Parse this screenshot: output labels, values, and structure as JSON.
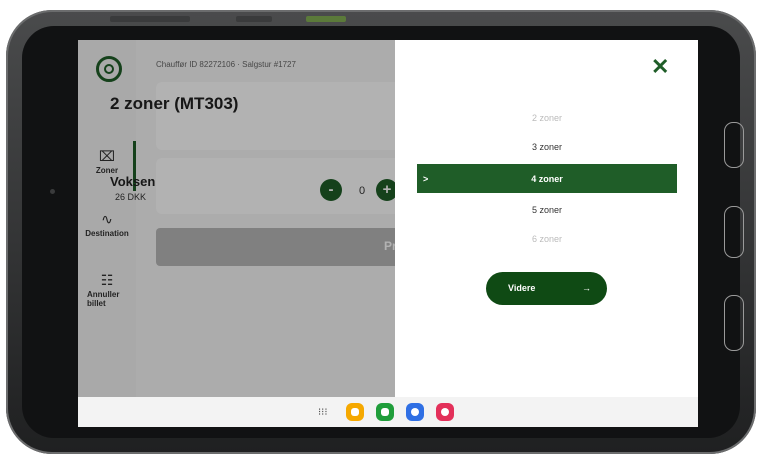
{
  "header": {
    "meta": "Chauffør ID 82272106 · Salgstur #1727"
  },
  "sidebar": {
    "items": [
      {
        "label": "Zoner",
        "icon": "ticket-icon"
      },
      {
        "label": "Destination",
        "icon": "route-icon"
      },
      {
        "label": "Annuller billet",
        "icon": "receipt-cancel-icon"
      }
    ]
  },
  "main": {
    "zone_title": "2 zoner (MT303)",
    "passenger": {
      "type": "Voksen",
      "price": "26 DKK",
      "quantity": "0",
      "minus": "-",
      "plus": "+"
    },
    "pay_button": "Pr"
  },
  "picker": {
    "close": "✕",
    "options": [
      "2 zoner",
      "3 zoner",
      "4 zoner",
      "5 zoner",
      "6 zoner"
    ],
    "selected_index": 2,
    "selected_caret": ">",
    "continue_label": "Videre",
    "continue_arrow": "→"
  },
  "navbar": {
    "apps_icon": "⁝⁝⁝"
  },
  "colors": {
    "brand_green": "#1f5d28",
    "cta_green": "#0f4a14"
  }
}
